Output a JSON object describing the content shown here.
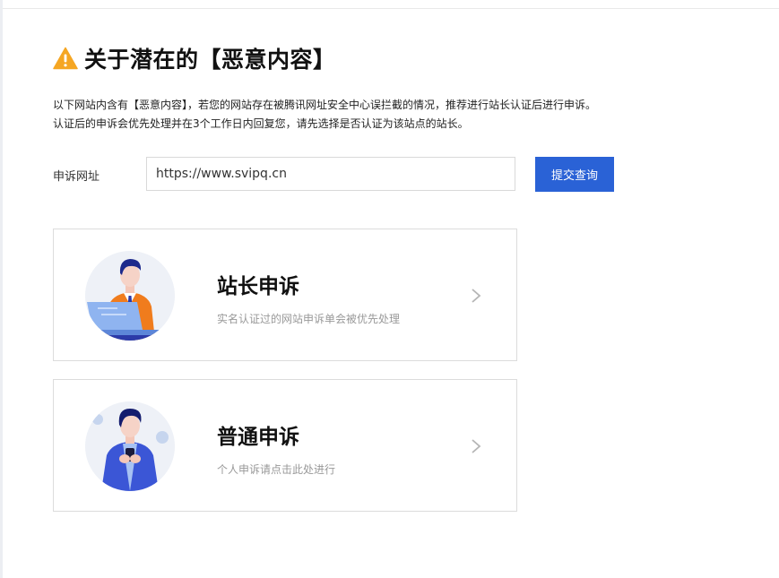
{
  "header": {
    "title": "关于潜在的【恶意内容】",
    "warning_icon": "warning-triangle-icon",
    "warning_color": "#f5a623"
  },
  "description": {
    "line1": "以下网站内含有【恶意内容】，若您的网站存在被腾讯网址安全中心误拦截的情况，推荐进行站长认证后进行申诉。",
    "line2": "认证后的申诉会优先处理并在3个工作日内回复您，请先选择是否认证为该站点的站长。"
  },
  "appeal_form": {
    "label": "申诉网址",
    "url_value": "https://www.svipq.cn",
    "submit_label": "提交查询",
    "accent_color": "#2a62d6"
  },
  "options": [
    {
      "title": "站长申诉",
      "subtitle": "实名认证过的网站申诉单会被优先处理",
      "illustration": "webmaster-avatar-icon",
      "arrow_icon": "chevron-right-icon"
    },
    {
      "title": "普通申诉",
      "subtitle": "个人申诉请点击此处进行",
      "illustration": "personal-avatar-icon",
      "arrow_icon": "chevron-right-icon"
    }
  ]
}
